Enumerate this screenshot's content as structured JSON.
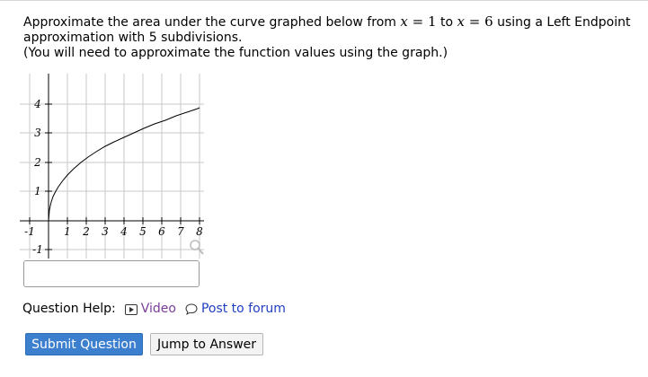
{
  "question": {
    "text_a": "Approximate the area under the curve graphed below from",
    "var_x": "x",
    "equals": "=",
    "x_start": "1",
    "to": "to",
    "x_end": "6",
    "text_b": "using a Left Endpoint approximation with 5 subdivisions.",
    "note": "(You will need to approximate the function values using the graph.)"
  },
  "graph": {
    "x_tick_labels": [
      "-1",
      "1",
      "2",
      "3",
      "4",
      "5",
      "6",
      "7",
      "8"
    ],
    "y_tick_labels": [
      "4",
      "3",
      "2",
      "1",
      "-1"
    ],
    "curve_color": "#000000",
    "grid_color": "#c8c8c8",
    "zoom_icon": "magnifier-icon"
  },
  "answer": {
    "value": ""
  },
  "help": {
    "label": "Question Help:",
    "video_icon": "video-play-icon",
    "video_label": "Video",
    "forum_icon": "speech-bubble-icon",
    "forum_label": "Post to forum"
  },
  "buttons": {
    "submit_label": "Submit Question",
    "jump_label": "Jump to Answer"
  },
  "colors": {
    "submit_bg": "#3c7fcf",
    "video_link": "#7a3d9a",
    "forum_link": "#2040c0"
  }
}
